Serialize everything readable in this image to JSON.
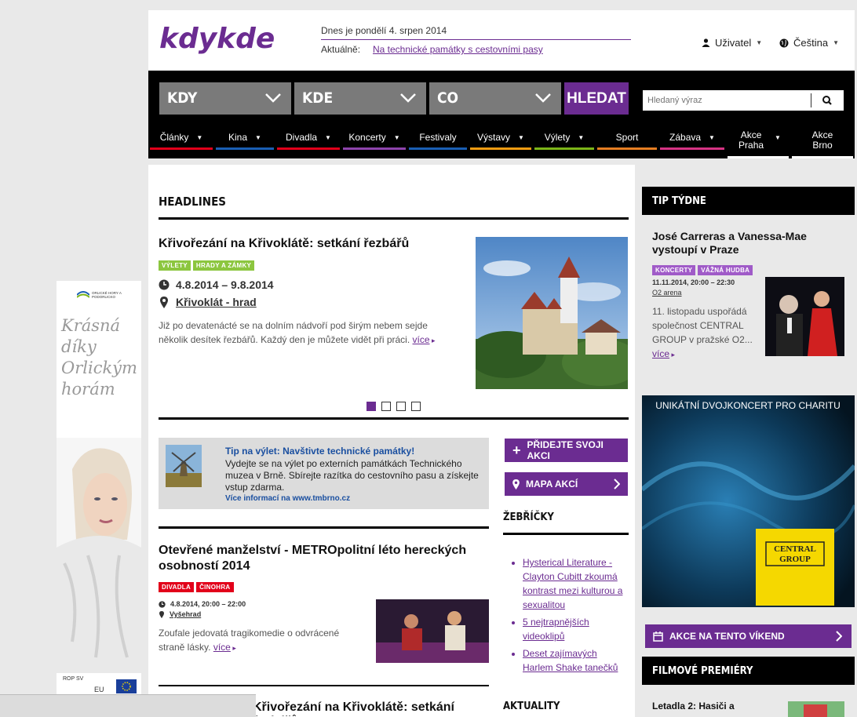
{
  "header": {
    "logo_text": "kdykde",
    "date": "Dnes je pondělí 4. srpen 2014",
    "aktualne_label": "Aktuálně:",
    "aktualne_link": "Na technické památky s cestovními pasy",
    "user_label": "Uživatel",
    "lang_label": "Čeština"
  },
  "searchbar": {
    "kdy": "KDY",
    "kde": "KDE",
    "co": "CO",
    "submit": "HLEDAT",
    "placeholder": "Hledaný výraz"
  },
  "nav": [
    {
      "label": "Články",
      "caret": true,
      "color": "#e2001a"
    },
    {
      "label": "Kina",
      "caret": true,
      "color": "#1a5fb4"
    },
    {
      "label": "Divadla",
      "caret": true,
      "color": "#e2001a"
    },
    {
      "label": "Koncerty",
      "caret": true,
      "color": "#8e44ad"
    },
    {
      "label": "Festivaly",
      "caret": false,
      "color": "#1a5fb4"
    },
    {
      "label": "Výstavy",
      "caret": true,
      "color": "#f39c12"
    },
    {
      "label": "Výlety",
      "caret": true,
      "color": "#7cb518"
    },
    {
      "label": "Sport",
      "caret": false,
      "color": "#e67e22"
    },
    {
      "label": "Zábava",
      "caret": true,
      "color": "#d63384"
    },
    {
      "label": "Akce Praha",
      "caret": true,
      "color": "#ffffff"
    },
    {
      "label": "Akce Brno",
      "caret": false,
      "color": "#ffffff"
    }
  ],
  "headlines": {
    "title": "HEADLINES",
    "article": {
      "title": "Křivořezání na Křivoklátě: setkání řezbářů",
      "tags": [
        {
          "label": "VÝLETY",
          "color": "#8cc63f"
        },
        {
          "label": "HRADY A ZÁMKY",
          "color": "#8cc63f"
        }
      ],
      "date": "4.8.2014 – 9.8.2014",
      "place": "Křivoklát - hrad",
      "text": "Již po devatenácté se na dolním nádvoří pod širým nebem sejde několik desítek řezbářů. Každý den je můžete vidět při práci.",
      "more": "více"
    },
    "slides": 4,
    "active_slide": 1
  },
  "tip": {
    "title": "Tip na výlet: Navštivte technické památky!",
    "text": "Vydejte se na výlet po externích památkách Technického muzea v Brně. Sbírejte razítka do cestovního pasu a získejte vstup zdarma.",
    "link": "Více informací na www.tmbrno.cz"
  },
  "actions": {
    "add": "PŘIDEJTE SVOJI AKCI",
    "map": "MAPA AKCÍ"
  },
  "zebricky": {
    "title": "ŽEBŘÍČKY",
    "items": [
      "Hysterical Literature - Clayton Cubitt zkoumá kontrast mezi kulturou a sexualitou",
      "5 nejtrapnějších videoklipů",
      "Deset zajímavých Harlem Shake tanečků"
    ]
  },
  "article2": {
    "title": "Otevřené manželství - METROpolitní léto hereckých osobností 2014",
    "tags": [
      {
        "label": "DIVADLA",
        "color": "#e2001a"
      },
      {
        "label": "ČINOHRA",
        "color": "#e2001a"
      }
    ],
    "date": "4.8.2014, 20:00 – 22:00",
    "place": "Vyšehrad",
    "text": "Zoufale jedovatá tragikomedie o odvrácené straně lásky.",
    "more": "více"
  },
  "article3": {
    "title": "Křivořezání na Křivoklátě: setkání řezbářů"
  },
  "aktuality": {
    "title": "AKTUALITY"
  },
  "tip_tydne": {
    "title": "TIP TÝDNE",
    "event_title": "José Carreras a Vanessa-Mae vystoupí v Praze",
    "tags": [
      {
        "label": "KONCERTY",
        "color": "#a05bc8"
      },
      {
        "label": "VÁŽNÁ HUDBA",
        "color": "#a05bc8"
      }
    ],
    "date": "11.11.2014, 20:00 – 22:30",
    "place": "O2 arena",
    "text": "11. listopadu uspořádá společnost CENTRAL GROUP v pražské O2...",
    "more": "více"
  },
  "charity_banner": {
    "title": "UNIKÁTNÍ DVOJKONCERT PRO CHARITU",
    "logo_line1": "CENTRAL",
    "logo_line2": "GROUP"
  },
  "weekend": {
    "label": "AKCE NA TENTO VÍKEND"
  },
  "premiery": {
    "title": "FILMOVÉ PREMIÉRY",
    "first": "Letadla 2: Hasiči a"
  },
  "ad": {
    "brand": "ORLICKÉ HORY A PODORLICKO",
    "slogan_1": "Krásná",
    "slogan_2": "díky",
    "slogan_3": "Orlickým",
    "slogan_4": "horám",
    "footer_left": "ROP SV",
    "footer_eu": "EU"
  }
}
